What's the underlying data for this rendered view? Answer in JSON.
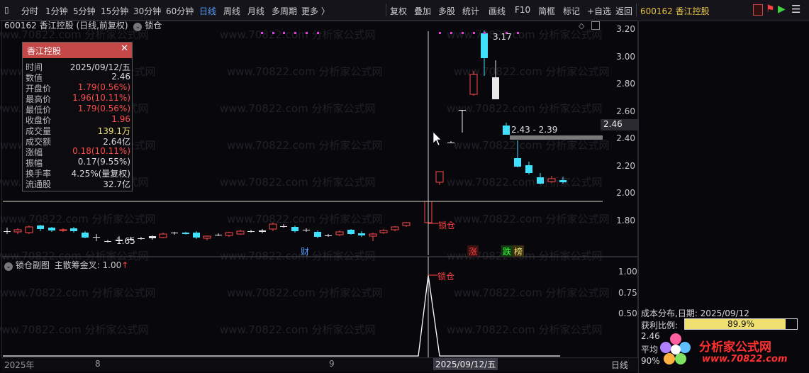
{
  "toolbar": {
    "left_items": [
      "分时",
      "1分钟",
      "5分钟",
      "15分钟",
      "30分钟",
      "60分钟",
      "日线",
      "周线",
      "月线",
      "多周期",
      "更多 〉"
    ],
    "active_item": "日线",
    "right_items": [
      "复权",
      "叠加",
      "多股",
      "统计",
      "画线",
      "F10",
      "简框",
      "标记",
      "+自选",
      "返回"
    ],
    "stock_title": "600162 香江控股"
  },
  "main_chart": {
    "title": "600162 香江控股 (日线,前复权)",
    "indicator_name": "锁仓",
    "price_labels": [
      "3.20",
      "3.00",
      "2.80",
      "2.60",
      "2.40",
      "2.20",
      "2.00",
      "1.80"
    ],
    "current_price_tag": "2.46",
    "annotations": {
      "high": "3.17",
      "low": "1.65",
      "gap_range": "2.43 - 2.39",
      "lock_marker": "锁仓"
    },
    "event_tags": [
      "财",
      "涨",
      "跌",
      "榜"
    ]
  },
  "info_box": {
    "title": "香江控股",
    "rows": [
      {
        "k": "时间",
        "v": "2025/09/12/五",
        "c": ""
      },
      {
        "k": "数值",
        "v": "2.46",
        "c": ""
      },
      {
        "k": "开盘价",
        "v": "1.79(0.56%)",
        "c": "red"
      },
      {
        "k": "最高价",
        "v": "1.96(10.11%)",
        "c": "red"
      },
      {
        "k": "最低价",
        "v": "1.79(0.56%)",
        "c": "red"
      },
      {
        "k": "收盘价",
        "v": "1.96",
        "c": "red"
      },
      {
        "k": "成交量",
        "v": "139.1万",
        "c": "yellow"
      },
      {
        "k": "成交额",
        "v": "2.64亿",
        "c": ""
      },
      {
        "k": "涨幅",
        "v": "0.18(10.11%)",
        "c": "red"
      },
      {
        "k": "振幅",
        "v": "0.17(9.55%)",
        "c": ""
      },
      {
        "k": "换手率",
        "v": "4.25%(量复权)",
        "c": ""
      },
      {
        "k": "流通股",
        "v": "32.7亿",
        "c": ""
      }
    ]
  },
  "sub_chart": {
    "title": "锁仓副图",
    "indicator_text": "主散筹金叉: 1.00",
    "marker": "锁仓",
    "scale_labels": [
      "1.00",
      "0.75",
      "0.50"
    ]
  },
  "date_axis": {
    "labels": [
      "2025年",
      "8",
      "9",
      "2025/09/12/五"
    ],
    "period": "日线"
  },
  "cost_panel": {
    "title": "成本分布,日期: 2025/09/12",
    "profit_label": "获利比例:",
    "profit_value": "89.9%",
    "avg_label_partial": "2.46",
    "avg_cost_partial": "平均",
    "pct_partial": "90%"
  },
  "watermark": "www.70822.com 分析家公式网",
  "logo_text": "分析家公式网",
  "logo_url": "www.70822.com",
  "colors": {
    "up": "#ff4a4a",
    "down": "#40e0ff",
    "accent": "#5aa0ff",
    "cost": "#f0e070"
  }
}
